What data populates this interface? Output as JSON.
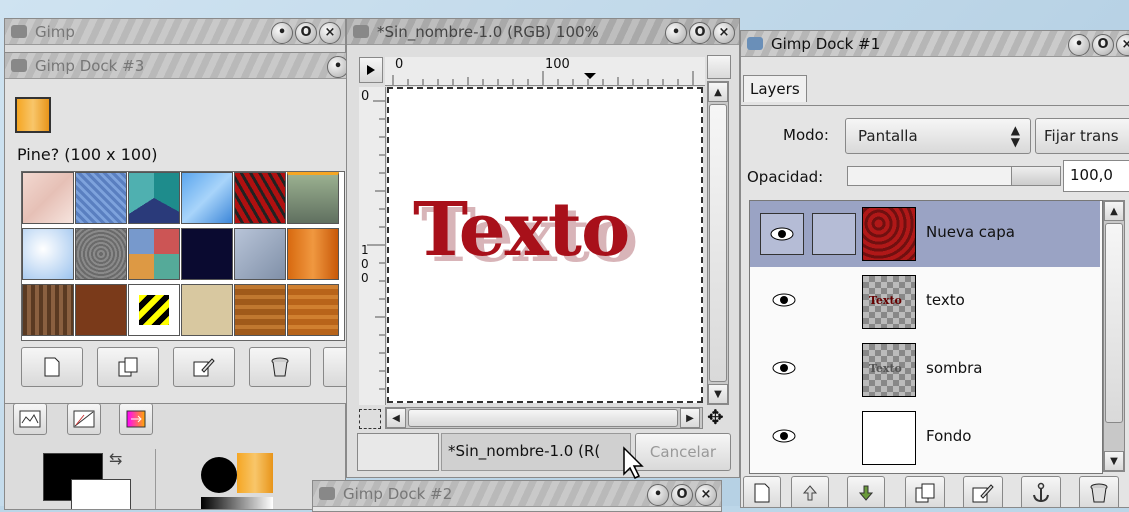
{
  "gimp_toolbox": {
    "title": "Gimp"
  },
  "dock3": {
    "title": "Gimp Dock #3",
    "pattern_name": "Pine? (100 x 100)"
  },
  "image_window": {
    "title": "*Sin_nombre-1.0 (RGB) 100%",
    "ruler_top_labels": [
      "0",
      "100"
    ],
    "ruler_left_labels": [
      "0",
      "1",
      "0",
      "0"
    ],
    "canvas_text": "Texto",
    "status_text": "*Sin_nombre-1.0 (R(",
    "cancel_label": "Cancelar"
  },
  "dock1": {
    "title": "Gimp Dock #1",
    "tab_label": "Layers",
    "mode_label": "Modo:",
    "mode_value": "Pantalla",
    "lock_label": "Fijar trans",
    "opacity_label": "Opacidad:",
    "opacity_value": "100,0",
    "layers": [
      {
        "name": "Nueva capa",
        "thumb_text": ""
      },
      {
        "name": "texto",
        "thumb_text": "Texto"
      },
      {
        "name": "sombra",
        "thumb_text": "Texto"
      },
      {
        "name": "Fondo",
        "thumb_text": ""
      }
    ]
  },
  "dock2": {
    "title": "Gimp Dock #2"
  },
  "colors": {
    "selected_layer": "#9aa3c4",
    "text_red": "#a8101a",
    "desktop": "#bcd6e8"
  }
}
